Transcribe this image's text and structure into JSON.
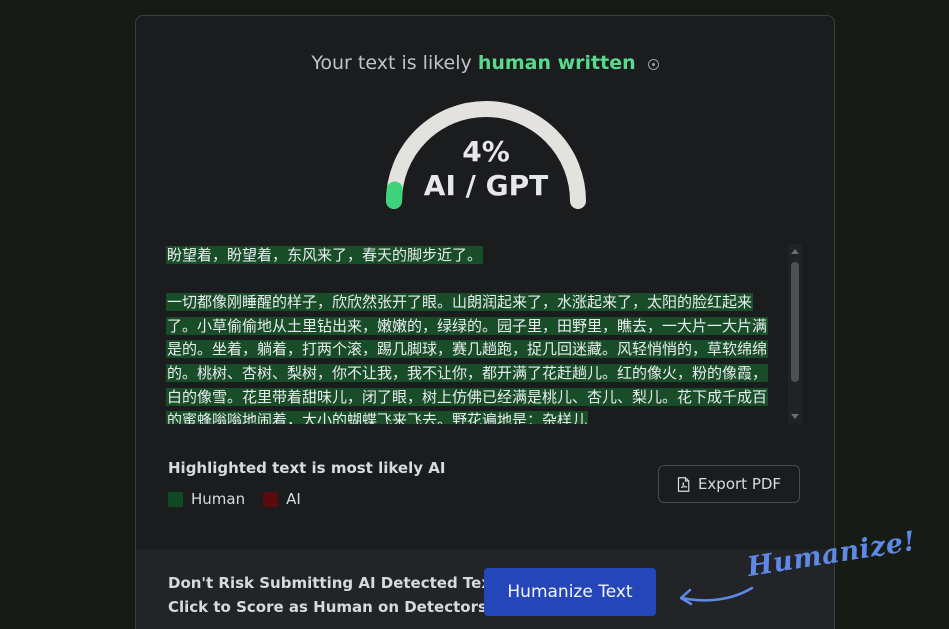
{
  "result": {
    "prefix": "Your text is likely",
    "verdict": "human written",
    "gauge": {
      "percent_label": "4%",
      "value_fraction": 0.04,
      "label": "AI / GPT",
      "track_color": "#e4e2de",
      "fill_color": "#3ed37a"
    }
  },
  "text": {
    "paragraphs": [
      "盼望着，盼望着，东风来了，春天的脚步近了。",
      "一切都像刚睡醒的样子，欣欣然张开了眼。山朗润起来了，水涨起来了，太阳的脸红起来了。小草偷偷地从土里钻出来，嫩嫩的，绿绿的。园子里，田野里，瞧去，一大片一大片满是的。坐着，躺着，打两个滚，踢几脚球，赛几趟跑，捉几回迷藏。风轻悄悄的，草软绵绵的。桃树、杏树、梨树，你不让我，我不让你，都开满了花赶趟儿。红的像火，粉的像霞，白的像雪。花里带着甜味儿，闭了眼，树上仿佛已经满是桃儿、杏儿、梨儿。花下成千成百的蜜蜂嗡嗡地闹着，大小的蝴蝶飞来飞去。野花遍地是：杂样儿"
    ],
    "highlight_color": "#184d28"
  },
  "legend": {
    "title": "Highlighted text is most likely AI",
    "items": [
      {
        "label": "Human",
        "color": "#0f4a22"
      },
      {
        "label": "AI",
        "color": "#5a0c0c"
      }
    ]
  },
  "export": {
    "label": "Export PDF",
    "icon": "pdf-file-icon"
  },
  "cta": {
    "line1": "Don't Risk Submitting AI Detected Text",
    "line2": "Click to Score as Human on Detectors",
    "button_label": "Humanize Text",
    "button_color": "#2546b8"
  },
  "annotation": {
    "text": "Humanize!",
    "color": "#5f89e6"
  }
}
